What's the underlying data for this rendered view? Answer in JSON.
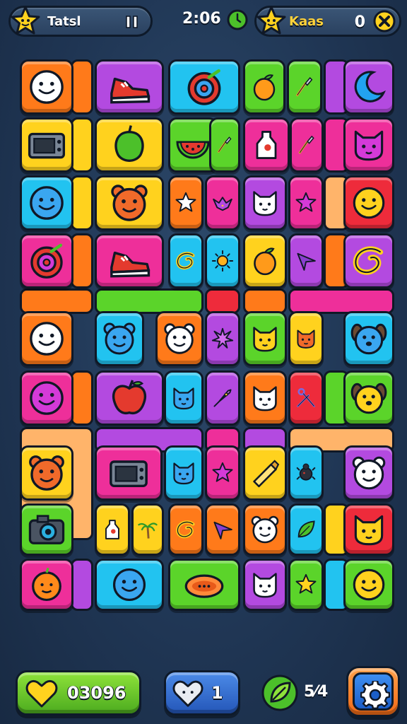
{
  "header": {
    "player_name": "Tatsl",
    "timer": "2:06",
    "opponent_label": "Kaas",
    "opponent_count": "0"
  },
  "colors": {
    "orange": "#ff7a1a",
    "purple": "#b34ae0",
    "cyan": "#22c3f0",
    "green": "#5bd42a",
    "yellow": "#ffd21e",
    "pink": "#ee2f9a",
    "red": "#ee2b3b",
    "peach": "#ffb46a"
  },
  "tiles": [
    {
      "id": "r1c1",
      "color": "orange",
      "icon": "smiley-face-icon"
    },
    {
      "id": "r1c2",
      "color": "purple",
      "icon": "sneaker-icon"
    },
    {
      "id": "r1c3",
      "color": "cyan",
      "icon": "target-apple-icon"
    },
    {
      "id": "r1c4",
      "color": "green",
      "icon": "mango-icon"
    },
    {
      "id": "r1c4b",
      "color": "green",
      "icon": "paintbrush-icon"
    },
    {
      "id": "r1c5",
      "color": "purple",
      "icon": "moon-icon"
    },
    {
      "id": "r2c1",
      "color": "yellow",
      "icon": "radio-icon"
    },
    {
      "id": "r2c2",
      "color": "yellow",
      "icon": "green-pepper-icon"
    },
    {
      "id": "r2c3",
      "color": "green",
      "icon": "watermelon-icon"
    },
    {
      "id": "r2c3b",
      "color": "green",
      "icon": "paintbrush-icon"
    },
    {
      "id": "r2c4",
      "color": "pink",
      "icon": "milk-bottle-icon"
    },
    {
      "id": "r2c4b",
      "color": "pink",
      "icon": "paintbrush-icon"
    },
    {
      "id": "r2c5",
      "color": "pink",
      "icon": "cat-face-icon"
    },
    {
      "id": "r3c1",
      "color": "cyan",
      "icon": "smiley-face-icon"
    },
    {
      "id": "r3c2",
      "color": "yellow",
      "icon": "bear-face-icon"
    },
    {
      "id": "r3c3",
      "color": "orange",
      "icon": "star-icon"
    },
    {
      "id": "r3c3b",
      "color": "pink",
      "icon": "bird-icon"
    },
    {
      "id": "r3c4",
      "color": "purple",
      "icon": "cat-face-icon"
    },
    {
      "id": "r3c4b",
      "color": "pink",
      "icon": "star-icon"
    },
    {
      "id": "r3c5",
      "color": "red",
      "icon": "smiley-face-icon"
    },
    {
      "id": "r4c1",
      "color": "pink",
      "icon": "target-apple-icon"
    },
    {
      "id": "r4c2",
      "color": "pink",
      "icon": "sneaker-icon"
    },
    {
      "id": "r4c3",
      "color": "cyan",
      "icon": "swirl-icon"
    },
    {
      "id": "r4c3b",
      "color": "cyan",
      "icon": "sun-icon"
    },
    {
      "id": "r4c4",
      "color": "yellow",
      "icon": "mango-icon"
    },
    {
      "id": "r4c4b",
      "color": "purple",
      "icon": "arrow-icon"
    },
    {
      "id": "r4c5",
      "color": "purple",
      "icon": "swirl-icon"
    },
    {
      "id": "r5c1",
      "color": "orange",
      "icon": "smiley-face-icon"
    },
    {
      "id": "r5c2",
      "color": "cyan",
      "icon": "bear-face-icon"
    },
    {
      "id": "r5c2b",
      "color": "orange",
      "icon": "bear-face-icon"
    },
    {
      "id": "r5c3",
      "color": "purple",
      "icon": "splat-icon"
    },
    {
      "id": "r5c4",
      "color": "green",
      "icon": "cat-face-icon"
    },
    {
      "id": "r5c4b",
      "color": "yellow",
      "icon": "cat-face-icon"
    },
    {
      "id": "r5c5",
      "color": "cyan",
      "icon": "dog-face-icon"
    },
    {
      "id": "r6c1",
      "color": "pink",
      "icon": "smiley-face-icon"
    },
    {
      "id": "r6c2",
      "color": "purple",
      "icon": "apple-icon"
    },
    {
      "id": "r6c3",
      "color": "cyan",
      "icon": "cat-face-icon"
    },
    {
      "id": "r6c3b",
      "color": "purple",
      "icon": "rocket-icon"
    },
    {
      "id": "r6c4",
      "color": "orange",
      "icon": "cat-face-icon"
    },
    {
      "id": "r6c4b",
      "color": "red",
      "icon": "scissors-icon"
    },
    {
      "id": "r6c5",
      "color": "green",
      "icon": "dog-face-icon"
    },
    {
      "id": "r7c1",
      "color": "yellow",
      "icon": "bear-face-icon"
    },
    {
      "id": "r7c2",
      "color": "pink",
      "icon": "radio-icon"
    },
    {
      "id": "r7c3",
      "color": "cyan",
      "icon": "cat-face-icon"
    },
    {
      "id": "r7c3b",
      "color": "pink",
      "icon": "star-icon"
    },
    {
      "id": "r7c4",
      "color": "yellow",
      "icon": "crayon-icon"
    },
    {
      "id": "r7c4b",
      "color": "cyan",
      "icon": "bug-icon"
    },
    {
      "id": "r7c5",
      "color": "purple",
      "icon": "bear-face-icon"
    },
    {
      "id": "r8c1",
      "color": "green",
      "icon": "camera-icon"
    },
    {
      "id": "r8c2",
      "color": "yellow",
      "icon": "milk-bottle-icon"
    },
    {
      "id": "r8c2b",
      "color": "yellow",
      "icon": "palm-tree-icon"
    },
    {
      "id": "r8c3",
      "color": "orange",
      "icon": "swirl-icon"
    },
    {
      "id": "r8c3b",
      "color": "orange",
      "icon": "arrow-icon"
    },
    {
      "id": "r8c4",
      "color": "orange",
      "icon": "bear-face-icon"
    },
    {
      "id": "r8c4b",
      "color": "cyan",
      "icon": "leaf-icon"
    },
    {
      "id": "r8c5",
      "color": "red",
      "icon": "cat-face-icon"
    },
    {
      "id": "r9c1",
      "color": "pink",
      "icon": "orange-fruit-icon"
    },
    {
      "id": "r9c2",
      "color": "cyan",
      "icon": "smiley-face-icon"
    },
    {
      "id": "r9c3",
      "color": "green",
      "icon": "papaya-icon"
    },
    {
      "id": "r9c4",
      "color": "purple",
      "icon": "cat-face-icon"
    },
    {
      "id": "r9c4b",
      "color": "green",
      "icon": "star-icon"
    },
    {
      "id": "r9c5",
      "color": "green",
      "icon": "smiley-face-icon"
    }
  ],
  "footer": {
    "score": "03096",
    "lives": "1",
    "leaf_count": "5⁄4"
  }
}
